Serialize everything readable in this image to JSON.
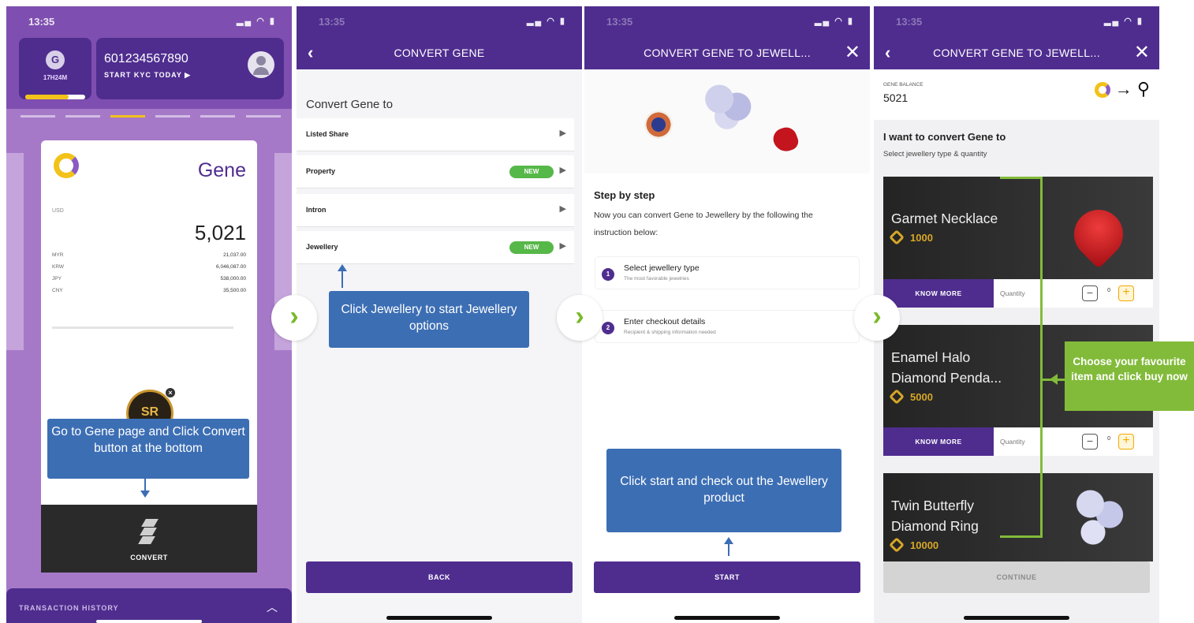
{
  "colors": {
    "brand_purple": "#4f2d8f",
    "callout_blue": "#3c6eb4",
    "accent_green": "#82bb3a",
    "new_badge_green": "#56b848",
    "gene_gold": "#f2c21a"
  },
  "status": {
    "time": "13:35",
    "time_faded": "13:35"
  },
  "p1": {
    "timer": "17H24M",
    "timer_progress_percent": 72,
    "account_number": "601234567890",
    "kyc_label": "START KYC TODAY ▶",
    "card_title": "Gene",
    "currency_label": "USD",
    "balance": "5,021",
    "rates": [
      {
        "code": "MYR",
        "value": "21,037.00"
      },
      {
        "code": "KRW",
        "value": "6,046,087.00"
      },
      {
        "code": "JPY",
        "value": "538,000.00"
      },
      {
        "code": "CNY",
        "value": "35,500.00"
      }
    ],
    "badge_text": "SR",
    "convert_label": "CONVERT",
    "tx_history_label": "TRANSACTION HISTORY"
  },
  "p2": {
    "nav_title": "CONVERT GENE",
    "heading": "Convert Gene to",
    "rows": [
      {
        "label": "Listed Share",
        "badge": ""
      },
      {
        "label": "Property",
        "badge": "NEW"
      },
      {
        "label": "Intron",
        "badge": ""
      },
      {
        "label": "Jewellery",
        "badge": "NEW"
      }
    ],
    "back_label": "BACK"
  },
  "p3": {
    "nav_title": "CONVERT GENE TO JEWELL...",
    "step_title": "Step by step",
    "step_text": "Now you can convert Gene to Jewellery by the following the instruction below:",
    "steps": [
      {
        "n": "1",
        "title": "Select jewellery type",
        "sub": "The most favorable jewelries"
      },
      {
        "n": "2",
        "title": "Enter checkout details",
        "sub": "Recipient & shipping information needed"
      }
    ],
    "start_label": "START"
  },
  "p4": {
    "nav_title": "CONVERT GENE TO JEWELL...",
    "balance_label": "GENE BALANCE",
    "balance_value": "5021",
    "want_title": "I want to convert Gene to",
    "want_sub": "Select jewellery type & quantity",
    "products": [
      {
        "name": "Garmet Necklace",
        "price": "1000",
        "quantity": "0"
      },
      {
        "name": "Enamel Halo Diamond Penda...",
        "price": "5000",
        "quantity": "0"
      },
      {
        "name": "Twin Butterfly Diamond Ring",
        "price": "10000",
        "quantity": ""
      }
    ],
    "know_more_label": "KNOW MORE",
    "quantity_label": "Quantity",
    "continue_label": "CONTINUE"
  },
  "callouts": {
    "c1": "Go to Gene page and Click Convert button at the bottom",
    "c2": "Click Jewellery to start Jewellery options",
    "c3": "Click start and check out the Jewellery product",
    "c4": "Choose your favourite item and click buy now"
  },
  "next_glyph": "›"
}
